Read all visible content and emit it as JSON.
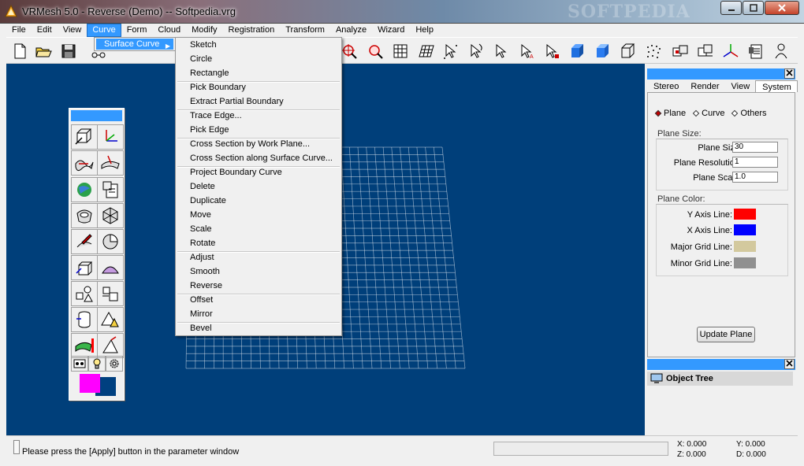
{
  "window": {
    "title": "VRMesh 5.0 - Reverse (Demo) -- Softpedia.vrg",
    "watermark": "SOFTPEDIA"
  },
  "menubar": [
    "File",
    "Edit",
    "View",
    "Curve",
    "Form",
    "Cloud",
    "Modify",
    "Registration",
    "Transform",
    "Analyze",
    "Wizard",
    "Help"
  ],
  "curve_menu": {
    "selected": "Surface Curve"
  },
  "surface_curve_menu": {
    "groups": [
      [
        "Sketch",
        "Circle",
        "Rectangle"
      ],
      [
        "Pick Boundary",
        "Extract Partial Boundary"
      ],
      [
        "Trace Edge...",
        "Pick Edge"
      ],
      [
        "Cross Section by Work Plane...",
        "Cross Section along Surface Curve..."
      ],
      [
        "Project Boundary Curve",
        "Delete",
        "Duplicate",
        "Move",
        "Scale",
        "Rotate"
      ],
      [
        "Adjust",
        "Smooth",
        "Reverse"
      ],
      [
        "Offset",
        "Mirror"
      ],
      [
        "Bevel"
      ]
    ]
  },
  "right_panel": {
    "tabs": [
      "Stereo",
      "Render",
      "View",
      "System"
    ],
    "active_tab": "System",
    "radio": {
      "options": [
        "Plane",
        "Curve",
        "Others"
      ],
      "selected": "Plane"
    },
    "plane_size": {
      "title": "Plane Size:",
      "fields": [
        {
          "label": "Plane Size:",
          "value": "30"
        },
        {
          "label": "Plane Resolution:",
          "value": "1"
        },
        {
          "label": "Plane Scale:",
          "value": "1.0"
        }
      ]
    },
    "plane_color": {
      "title": "Plane Color:",
      "items": [
        {
          "label": "Y Axis Line:",
          "color": "#ff0000"
        },
        {
          "label": "X Axis Line:",
          "color": "#0000ff"
        },
        {
          "label": "Major Grid Line:",
          "color": "#d3c99e"
        },
        {
          "label": "Minor Grid Line:",
          "color": "#909090"
        }
      ]
    },
    "update_button": "Update Plane",
    "object_tree": {
      "title": "Object Tree"
    }
  },
  "palette": {
    "foreground_color": "#ff00ff",
    "background_color": "#004080"
  },
  "status": {
    "message": "Please press the [Apply] button in the parameter window",
    "x": "X: 0.000",
    "y": "Y: 0.000",
    "z": "Z: 0.000",
    "d": "D: 0.000"
  },
  "colors": {
    "viewport": "#003f7a",
    "accent": "#3399ff"
  }
}
